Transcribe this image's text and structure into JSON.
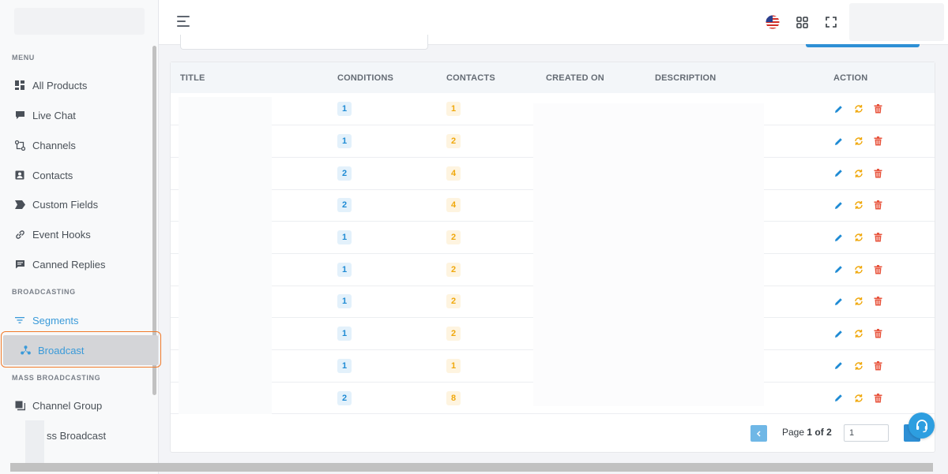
{
  "sidebar": {
    "headings": {
      "menu": "MENU",
      "broadcasting": "BROADCASTING",
      "mass_broadcasting": "MASS BROADCASTING"
    },
    "items": [
      {
        "label": "All Products",
        "icon": "dashboard-grid-icon"
      },
      {
        "label": "Live Chat",
        "icon": "chat-bubble-icon"
      },
      {
        "label": "Channels",
        "icon": "channels-icon"
      },
      {
        "label": "Contacts",
        "icon": "contacts-icon"
      },
      {
        "label": "Custom Fields",
        "icon": "tag-icon"
      },
      {
        "label": "Event Hooks",
        "icon": "link-icon"
      },
      {
        "label": "Canned Replies",
        "icon": "message-icon"
      },
      {
        "label": "Segments",
        "icon": "filter-icon"
      },
      {
        "label": "Broadcast",
        "icon": "broadcast-icon"
      },
      {
        "label": "Channel Group",
        "icon": "group-icon"
      },
      {
        "label": "ss Broadcast",
        "icon": ""
      }
    ]
  },
  "table": {
    "columns": [
      "TITLE",
      "CONDITIONS",
      "CONTACTS",
      "CREATED ON",
      "DESCRIPTION",
      "ACTION"
    ],
    "rows": [
      {
        "conditions": "1",
        "contacts": "1"
      },
      {
        "conditions": "1",
        "contacts": "2"
      },
      {
        "conditions": "2",
        "contacts": "4"
      },
      {
        "conditions": "2",
        "contacts": "4"
      },
      {
        "conditions": "1",
        "contacts": "2"
      },
      {
        "conditions": "1",
        "contacts": "2"
      },
      {
        "conditions": "1",
        "contacts": "2"
      },
      {
        "conditions": "1",
        "contacts": "2"
      },
      {
        "conditions": "1",
        "contacts": "1"
      },
      {
        "conditions": "2",
        "contacts": "8"
      }
    ]
  },
  "pagination": {
    "page_label": "Page",
    "current": "1",
    "of_label": "of",
    "total": "2",
    "input_value": "1"
  },
  "colors": {
    "accent": "#2d8fd5",
    "edit": "#1f8bd4",
    "refresh": "#f0a80c",
    "delete": "#e8553e",
    "highlight": "#f07a2a"
  }
}
